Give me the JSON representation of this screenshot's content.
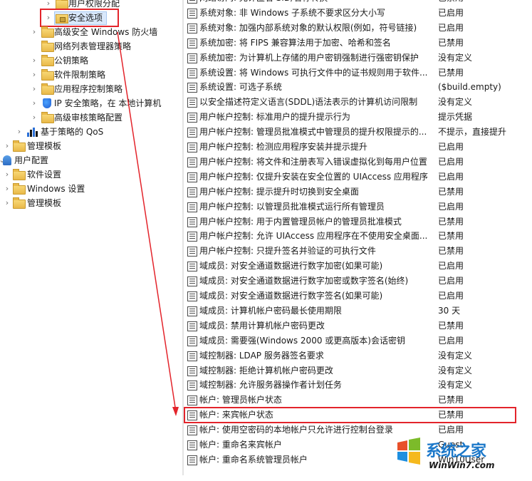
{
  "tree": {
    "items": [
      {
        "label": "用户权限分配",
        "icon": "folder-icon",
        "arrow": "chevron-right-icon"
      },
      {
        "label": "安全选项",
        "icon": "lock-folder-icon",
        "arrow": "chevron-right-icon",
        "selected": true
      },
      {
        "label": "高级安全 Windows 防火墙",
        "icon": "folder-icon",
        "arrow": "chevron-right-icon"
      },
      {
        "label": "网络列表管理器策略",
        "icon": "folder-icon"
      },
      {
        "label": "公钥策略",
        "icon": "folder-icon",
        "arrow": "chevron-right-icon"
      },
      {
        "label": "软件限制策略",
        "icon": "folder-icon",
        "arrow": "chevron-right-icon"
      },
      {
        "label": "应用程序控制策略",
        "icon": "folder-icon",
        "arrow": "chevron-right-icon"
      },
      {
        "label": "IP 安全策略，在 本地计算机",
        "icon": "shield-icon",
        "arrow": "chevron-right-icon"
      },
      {
        "label": "高级审核策略配置",
        "icon": "folder-icon",
        "arrow": "chevron-right-icon"
      },
      {
        "label": "基于策略的 QoS",
        "icon": "bar-chart-icon",
        "arrow": "chevron-right-icon"
      },
      {
        "label": "管理模板",
        "icon": "folder-icon",
        "arrow": "chevron-right-icon"
      },
      {
        "label": "用户配置",
        "icon": "user-config-icon",
        "arrow": "chevron-down-icon"
      },
      {
        "label": "软件设置",
        "icon": "folder-icon",
        "arrow": "chevron-right-icon"
      },
      {
        "label": "Windows 设置",
        "icon": "folder-icon",
        "arrow": "chevron-right-icon"
      },
      {
        "label": "管理模板",
        "icon": "folder-icon",
        "arrow": "chevron-right-icon"
      }
    ]
  },
  "policies": {
    "rows": [
      {
        "name": "网络访问: 允许匿名 SID/名称转换",
        "value": "已禁用"
      },
      {
        "name": "系统对象: 非 Windows 子系统不要求区分大小写",
        "value": "已启用"
      },
      {
        "name": "系统对象: 加强内部系统对象的默认权限(例如，符号链接)",
        "value": "已启用"
      },
      {
        "name": "系统加密: 将 FIPS 兼容算法用于加密、哈希和签名",
        "value": "已禁用"
      },
      {
        "name": "系统加密: 为计算机上存储的用户密钥强制进行强密钥保护",
        "value": "没有定义"
      },
      {
        "name": "系统设置: 将 Windows 可执行文件中的证书规则用于软件...",
        "value": "已禁用"
      },
      {
        "name": "系统设置: 可选子系统",
        "value": "($build.empty)"
      },
      {
        "name": "以安全描述符定义语言(SDDL)语法表示的计算机访问限制",
        "value": "没有定义"
      },
      {
        "name": "用户帐户控制: 标准用户的提升提示行为",
        "value": "提示凭据"
      },
      {
        "name": "用户帐户控制: 管理员批准模式中管理员的提升权限提示的...",
        "value": "不提示，直接提升"
      },
      {
        "name": "用户帐户控制: 检测应用程序安装并提示提升",
        "value": "已启用"
      },
      {
        "name": "用户帐户控制: 将文件和注册表写入错误虚拟化到每用户位置",
        "value": "已启用"
      },
      {
        "name": "用户帐户控制: 仅提升安装在安全位置的 UIAccess 应用程序",
        "value": "已启用"
      },
      {
        "name": "用户帐户控制: 提示提升时切换到安全桌面",
        "value": "已禁用"
      },
      {
        "name": "用户帐户控制: 以管理员批准模式运行所有管理员",
        "value": "已启用"
      },
      {
        "name": "用户帐户控制: 用于内置管理员帐户的管理员批准模式",
        "value": "已禁用"
      },
      {
        "name": "用户帐户控制: 允许 UIAccess 应用程序在不使用安全桌面...",
        "value": "已禁用"
      },
      {
        "name": "用户帐户控制: 只提升签名并验证的可执行文件",
        "value": "已禁用"
      },
      {
        "name": "域成员: 对安全通道数据进行数字加密(如果可能)",
        "value": "已启用"
      },
      {
        "name": "域成员: 对安全通道数据进行数字加密或数字签名(始终)",
        "value": "已启用"
      },
      {
        "name": "域成员: 对安全通道数据进行数字签名(如果可能)",
        "value": "已启用"
      },
      {
        "name": "域成员: 计算机帐户密码最长使用期限",
        "value": "30 天"
      },
      {
        "name": "域成员: 禁用计算机帐户密码更改",
        "value": "已禁用"
      },
      {
        "name": "域成员: 需要强(Windows 2000 或更高版本)会话密钥",
        "value": "已启用"
      },
      {
        "name": "域控制器: LDAP 服务器签名要求",
        "value": "没有定义"
      },
      {
        "name": "域控制器: 拒绝计算机帐户密码更改",
        "value": "没有定义"
      },
      {
        "name": "域控制器: 允许服务器操作者计划任务",
        "value": "没有定义"
      },
      {
        "name": "帐户: 管理员帐户状态",
        "value": "已禁用"
      },
      {
        "name": "帐户: 来宾帐户状态",
        "value": "已禁用",
        "highlighted": true
      },
      {
        "name": "帐户: 使用空密码的本地帐户只允许进行控制台登录",
        "value": "已启用"
      },
      {
        "name": "帐户: 重命名来宾帐户",
        "value": "Guest"
      },
      {
        "name": "帐户: 重命名系统管理员帐户",
        "value": "Win10User"
      }
    ]
  },
  "watermark": {
    "title": "系统之家",
    "subtitle": "WinWin7.com"
  },
  "colors": {
    "highlight_red": "#e3242b",
    "selection_blue": "#d9e8fb"
  }
}
